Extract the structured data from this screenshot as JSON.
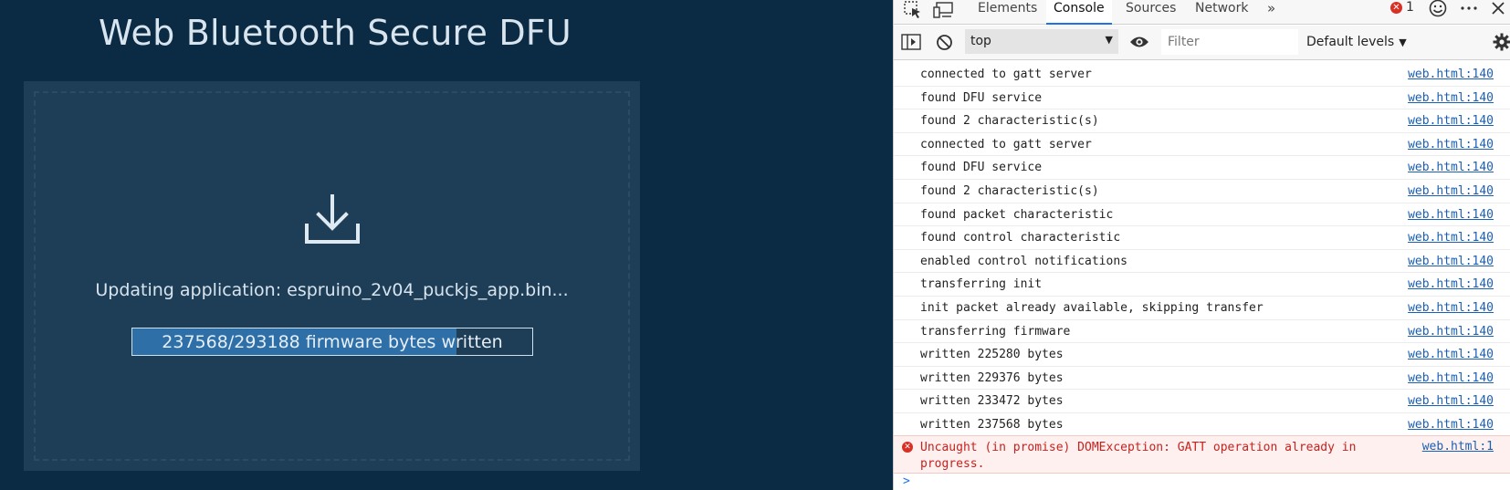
{
  "page": {
    "title": "Web Bluetooth Secure DFU",
    "status": "Updating application: espruino_2v04_puckjs_app.bin...",
    "progress": {
      "label": "237568/293188 firmware bytes written",
      "bytes_written": 237568,
      "bytes_total": 293188
    },
    "icon": "download-icon"
  },
  "devtools": {
    "tabs": [
      {
        "label": "Elements",
        "active": false
      },
      {
        "label": "Console",
        "active": true
      },
      {
        "label": "Sources",
        "active": false
      },
      {
        "label": "Network",
        "active": false
      }
    ],
    "more_tabs": "»",
    "error_count": "1",
    "toolbar": {
      "context": "top",
      "filter_placeholder": "Filter",
      "levels": "Default levels"
    },
    "log": [
      {
        "message": "connected to gatt server",
        "source": "web.html:140"
      },
      {
        "message": "found DFU service",
        "source": "web.html:140"
      },
      {
        "message": "found 2 characteristic(s)",
        "source": "web.html:140"
      },
      {
        "message": "connected to gatt server",
        "source": "web.html:140"
      },
      {
        "message": "found DFU service",
        "source": "web.html:140"
      },
      {
        "message": "found 2 characteristic(s)",
        "source": "web.html:140"
      },
      {
        "message": "found packet characteristic",
        "source": "web.html:140"
      },
      {
        "message": "found control characteristic",
        "source": "web.html:140"
      },
      {
        "message": "enabled control notifications",
        "source": "web.html:140"
      },
      {
        "message": "transferring init",
        "source": "web.html:140"
      },
      {
        "message": "init packet already available, skipping transfer",
        "source": "web.html:140"
      },
      {
        "message": "transferring firmware",
        "source": "web.html:140"
      },
      {
        "message": "written 225280 bytes",
        "source": "web.html:140"
      },
      {
        "message": "written 229376 bytes",
        "source": "web.html:140"
      },
      {
        "message": "written 233472 bytes",
        "source": "web.html:140"
      },
      {
        "message": "written 237568 bytes",
        "source": "web.html:140"
      }
    ],
    "error": {
      "message": "Uncaught (in promise) DOMException: GATT operation already in progress.",
      "source": "web.html:1"
    },
    "prompt": ">"
  },
  "colors": {
    "page_bg": "#0b2a44",
    "panel_bg": "#1e3e58",
    "progress_fill": "#2e6fa8",
    "error_red": "#d93025",
    "link_blue": "#1a5fb4"
  }
}
